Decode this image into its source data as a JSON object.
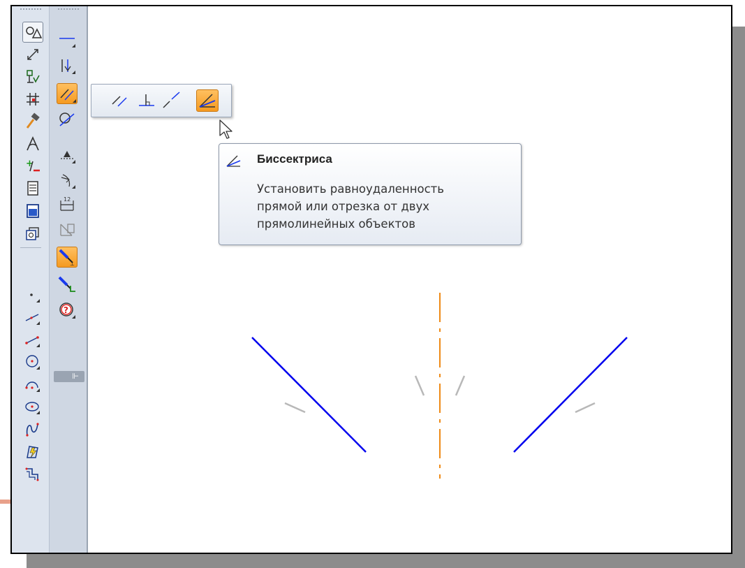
{
  "tooltip": {
    "title": "Биссектриса",
    "description_lines": [
      "Установить равноудаленность",
      "прямой или отрезка от двух",
      "прямолинейных объектов"
    ]
  },
  "panel2": {
    "expand_glyph": "⊩"
  },
  "colors": {
    "accent_orange": "#f59a20",
    "line_blue": "#0000ee",
    "axis_orange": "#ef8a16",
    "hint_gray": "#b8b8b8"
  },
  "icons": {
    "panel1": [
      "show-all-icon",
      "dimension-icon",
      "constraint-icon",
      "grid-icon",
      "edit-hammer-icon",
      "geometry-icon",
      "parametrize-icon",
      "spec-sheet-icon",
      "view-icon",
      "3d-icon",
      "point-icon",
      "line-icon",
      "segment-icon",
      "circle-icon",
      "arc-icon",
      "ellipse-icon",
      "spline-icon",
      "mixed-icon",
      "contour-icon"
    ],
    "panel2": [
      "horizontal-icon",
      "fix-point-icon",
      "parallel-icon",
      "tangent-icon",
      "symmetry-icon",
      "angle-icon",
      "dimension-12-icon",
      "dependency-icon",
      "auto-constraint-icon",
      "point-on-curve-icon",
      "help-icon"
    ],
    "flyout": [
      "parallel-icon",
      "perpendicular-icon",
      "collinear-icon",
      "bisector-icon"
    ]
  }
}
